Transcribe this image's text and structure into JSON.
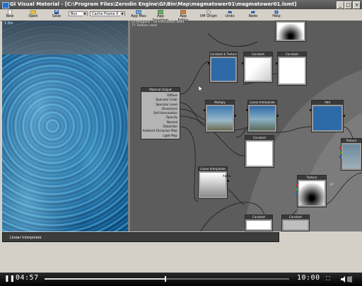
{
  "window": {
    "title": "GI Visual Material - [C:\\Program Files\\Zerodin Engine\\GI\\Bin\\Map\\magmatower01\\magmatower01.lsmt]",
    "controls": [
      "_",
      "□",
      "×"
    ]
  },
  "toolbar": {
    "new": "New",
    "open": "Open",
    "save": "Save",
    "shape_value": "Box",
    "cache_value": "Cache Frame 0",
    "app_max": "App Max",
    "app_splatting": "App Splatting",
    "app_editor": "App Editor",
    "vm_origin": "VM Origin",
    "undo": "Undo",
    "redo": "Redo",
    "help": "Help"
  },
  "viewport": {
    "fps": "1 fps"
  },
  "graph": {
    "header_line1": "GI Polygons : 50 Instruction used",
    "header_line2": "77 Texture used",
    "master_title": "Material Output",
    "master_inputs": [
      "Diffuse",
      "Specular Color",
      "Specular Level",
      "Glossiness",
      "Self Illumination",
      "Opacity",
      "Normal",
      "Distortion",
      "Ambient Occlusion Map",
      "Light Map"
    ],
    "nodes": {
      "constant_texture": "Constant & Texture",
      "constant1": "Constant",
      "constant2": "Constant",
      "multiply": "Multiply",
      "linear_interp1": "Linear Interpolate",
      "add": "Add",
      "constant3": "Constant",
      "linear_interp2": "Linear Interpolate",
      "texture1": "Texture",
      "texture2": "Texture",
      "constant4": "Constant",
      "constant5": "Constant"
    },
    "port_labels": {
      "lerp_alpha": "Alpha",
      "tex_uv": "UV"
    }
  },
  "property": {
    "selected": "Linear Interpolate"
  },
  "player": {
    "current_time": "04:57",
    "total_time": "10:00",
    "progress": 0.495
  },
  "colors": {
    "blue_swatch": "#2f6aa8",
    "graph_bg": "#5c5c5c",
    "window_face": "#d4d0c8"
  }
}
